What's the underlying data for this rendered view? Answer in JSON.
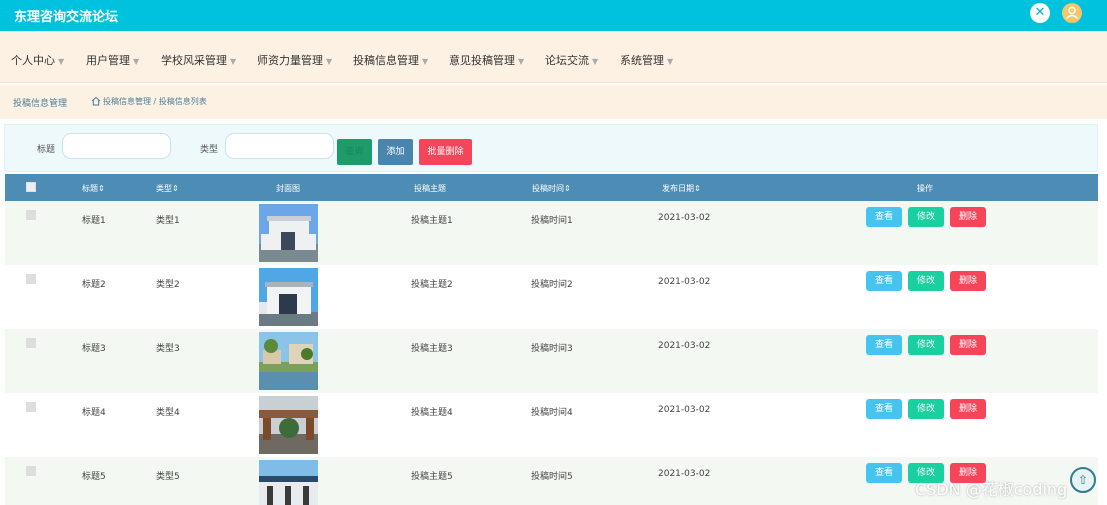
{
  "header": {
    "title": "东理咨询交流论坛",
    "close_icon": "x-icon",
    "avatar_icon": "user-icon"
  },
  "nav": {
    "items": [
      {
        "label": "个人中心"
      },
      {
        "label": "用户管理"
      },
      {
        "label": "学校风采管理"
      },
      {
        "label": "师资力量管理"
      },
      {
        "label": "投稿信息管理"
      },
      {
        "label": "意见投稿管理"
      },
      {
        "label": "论坛交流"
      },
      {
        "label": "系统管理"
      }
    ]
  },
  "breadcrumb": {
    "title": "投稿信息管理",
    "path": "投稿信息管理 / 投稿信息列表",
    "home_icon": "home-icon"
  },
  "filter": {
    "title_label": "标题",
    "title_value": "",
    "type_label": "类型",
    "type_value": "",
    "search_label": "查询",
    "add_label": "添加",
    "batch_delete_label": "批量删除"
  },
  "table": {
    "headers": {
      "title": "标题",
      "type": "类型",
      "cover": "封面图",
      "topic": "投稿主题",
      "time": "投稿时间",
      "date": "发布日期",
      "actions": "操作"
    },
    "actions": {
      "view": "查看",
      "edit": "修改",
      "delete": "删除"
    },
    "rows": [
      {
        "title": "标题1",
        "type": "类型1",
        "topic": "投稿主题1",
        "time": "投稿时间1",
        "date": "2021-03-02"
      },
      {
        "title": "标题2",
        "type": "类型2",
        "topic": "投稿主题2",
        "time": "投稿时间2",
        "date": "2021-03-02"
      },
      {
        "title": "标题3",
        "type": "类型3",
        "topic": "投稿主题3",
        "time": "投稿时间3",
        "date": "2021-03-02"
      },
      {
        "title": "标题4",
        "type": "类型4",
        "topic": "投稿主题4",
        "time": "投稿时间4",
        "date": "2021-03-02"
      },
      {
        "title": "标题5",
        "type": "类型5",
        "topic": "投稿主题5",
        "time": "投稿时间5",
        "date": "2021-03-02"
      }
    ]
  },
  "watermark": "CSDN @花椒coding",
  "colors": {
    "topbar": "#00c1de",
    "table_header": "#4d8db5",
    "view": "#44c4ef",
    "edit": "#18d0a0",
    "delete": "#f5455b"
  }
}
